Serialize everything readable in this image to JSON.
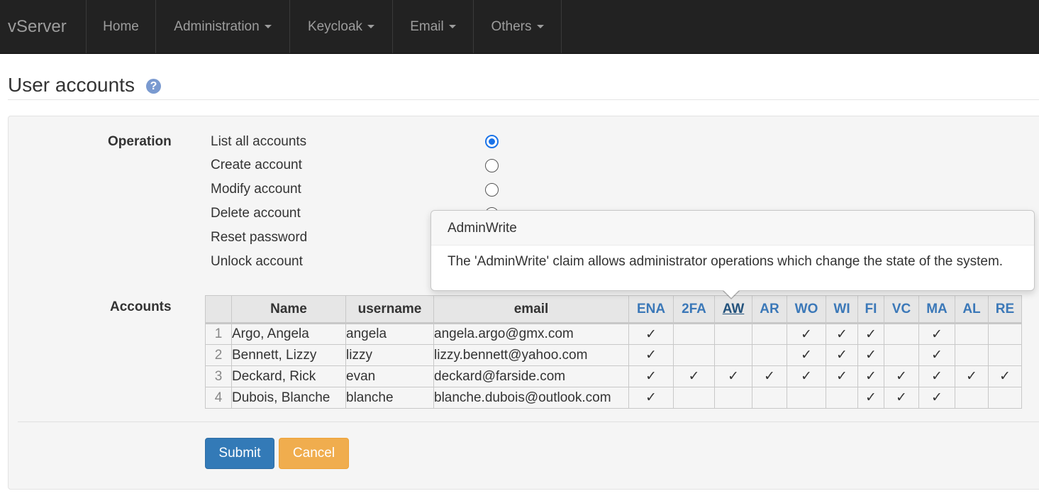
{
  "navbar": {
    "brand": "vServer",
    "items": [
      {
        "label": "Home",
        "dropdown": false
      },
      {
        "label": "Administration",
        "dropdown": true
      },
      {
        "label": "Keycloak",
        "dropdown": true
      },
      {
        "label": "Email",
        "dropdown": true
      },
      {
        "label": "Others",
        "dropdown": true
      }
    ]
  },
  "page": {
    "title": "User accounts",
    "help_glyph": "?"
  },
  "form": {
    "operation_label": "Operation",
    "operations": [
      {
        "label": "List all accounts",
        "checked": true
      },
      {
        "label": "Create account",
        "checked": false
      },
      {
        "label": "Modify account",
        "checked": false
      },
      {
        "label": "Delete account",
        "checked": false
      },
      {
        "label": "Reset password",
        "checked": false
      },
      {
        "label": "Unlock account",
        "checked": false
      }
    ],
    "accounts_label": "Accounts"
  },
  "table": {
    "headers": [
      "",
      "Name",
      "username",
      "email"
    ],
    "claims": [
      "ENA",
      "2FA",
      "AW",
      "AR",
      "WO",
      "WI",
      "FI",
      "VC",
      "MA",
      "AL",
      "RE"
    ],
    "active_claim": "AW",
    "check_glyph": "✓",
    "rows": [
      {
        "idx": "1",
        "name": "Argo, Angela",
        "username": "angela",
        "email": "angela.argo@gmx.com",
        "claims": [
          true,
          false,
          false,
          false,
          true,
          true,
          true,
          false,
          true,
          false,
          false
        ]
      },
      {
        "idx": "2",
        "name": "Bennett, Lizzy",
        "username": "lizzy",
        "email": "lizzy.bennett@yahoo.com",
        "claims": [
          true,
          false,
          false,
          false,
          true,
          true,
          true,
          false,
          true,
          false,
          false
        ]
      },
      {
        "idx": "3",
        "name": "Deckard, Rick",
        "username": "evan",
        "email": "deckard@farside.com",
        "claims": [
          true,
          true,
          true,
          true,
          true,
          true,
          true,
          true,
          true,
          true,
          true
        ]
      },
      {
        "idx": "4",
        "name": "Dubois, Blanche",
        "username": "blanche",
        "email": "blanche.dubois@outlook.com",
        "claims": [
          true,
          false,
          false,
          false,
          false,
          false,
          true,
          true,
          true,
          false,
          false
        ]
      }
    ]
  },
  "tooltip": {
    "title": "AdminWrite",
    "content": "The 'AdminWrite' claim allows administrator operations which change the state of the system."
  },
  "buttons": {
    "submit": "Submit",
    "cancel": "Cancel"
  },
  "colors": {
    "navbar_bg": "#222222",
    "primary": "#337ab7",
    "warning": "#f0ad4e",
    "link": "#3b78b8"
  }
}
